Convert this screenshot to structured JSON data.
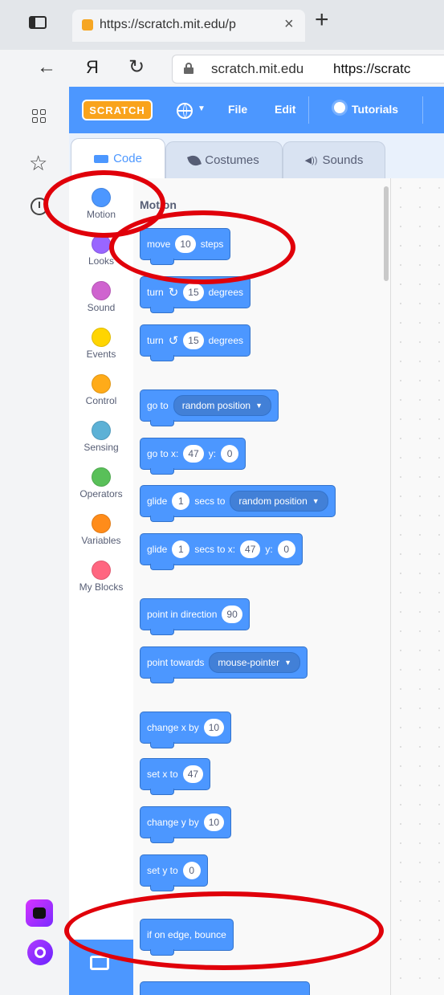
{
  "browser": {
    "tab_title": "https://scratch.mit.edu/p",
    "tab_close": "×",
    "new_tab": "+",
    "back": "←",
    "yandex_logo": "Я",
    "reload": "↻",
    "address_domain": "scratch.mit.edu",
    "address_url": "https://scratc"
  },
  "menubar": {
    "logo": "SCRATCH",
    "file": "File",
    "edit": "Edit",
    "tutorials": "Tutorials"
  },
  "editor_tabs": {
    "code": "Code",
    "costumes": "Costumes",
    "sounds": "Sounds"
  },
  "categories": [
    {
      "label": "Motion",
      "color": "#4c97ff"
    },
    {
      "label": "Looks",
      "color": "#9966ff"
    },
    {
      "label": "Sound",
      "color": "#cf63cf"
    },
    {
      "label": "Events",
      "color": "#ffd500"
    },
    {
      "label": "Control",
      "color": "#ffab19"
    },
    {
      "label": "Sensing",
      "color": "#5cb1d6"
    },
    {
      "label": "Operators",
      "color": "#59c059"
    },
    {
      "label": "Variables",
      "color": "#ff8c1a"
    },
    {
      "label": "My Blocks",
      "color": "#ff6680"
    }
  ],
  "palette": {
    "heading": "Motion",
    "move": {
      "a": "move",
      "n": "10",
      "b": "steps"
    },
    "turn_right": {
      "a": "turn",
      "n": "15",
      "b": "degrees"
    },
    "turn_left": {
      "a": "turn",
      "n": "15",
      "b": "degrees"
    },
    "goto": {
      "a": "go to",
      "menu": "random position"
    },
    "gotoxy": {
      "a": "go to x:",
      "x": "47",
      "b": "y:",
      "y": "0"
    },
    "glide_to": {
      "a": "glide",
      "n": "1",
      "b": "secs to",
      "menu": "random position"
    },
    "glide_xy": {
      "a": "glide",
      "n": "1",
      "b": "secs to x:",
      "x": "47",
      "c": "y:",
      "y": "0"
    },
    "point_dir": {
      "a": "point in direction",
      "n": "90"
    },
    "point_towards": {
      "a": "point towards",
      "menu": "mouse-pointer"
    },
    "change_x": {
      "a": "change x by",
      "n": "10"
    },
    "set_x": {
      "a": "set x to",
      "n": "47"
    },
    "change_y": {
      "a": "change y by",
      "n": "10"
    },
    "set_y": {
      "a": "set y to",
      "n": "0"
    },
    "bounce": {
      "a": "if on edge, bounce"
    }
  },
  "annotations": {
    "circle_color": "#e0000a"
  }
}
